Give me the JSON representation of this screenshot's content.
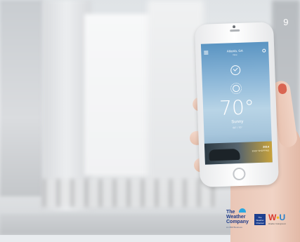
{
  "page": {
    "number": "9"
  },
  "weather_app": {
    "location": "Atlanta, GA",
    "sublocation": "Now",
    "temperature": "70°",
    "condition": "Sunny",
    "hilo": "88° / 70°",
    "ad": {
      "headline": "2014",
      "subline": "EASY SHOPPING"
    }
  },
  "logos": {
    "twc_line1": "The",
    "twc_line2": "Weather",
    "twc_line3": "Company",
    "twc_tagline": "An IBM Business",
    "channel": "The Weather Channel",
    "wu_mark_w": "W",
    "wu_mark_u": "U",
    "wu_mark_dot": "•",
    "wu_sub": "Weather Underground"
  },
  "colors": {
    "twc_blue": "#1f3c8a",
    "swoosh": "#2aa7e0",
    "wu_red": "#d83a2e",
    "nail": "#d96552"
  }
}
